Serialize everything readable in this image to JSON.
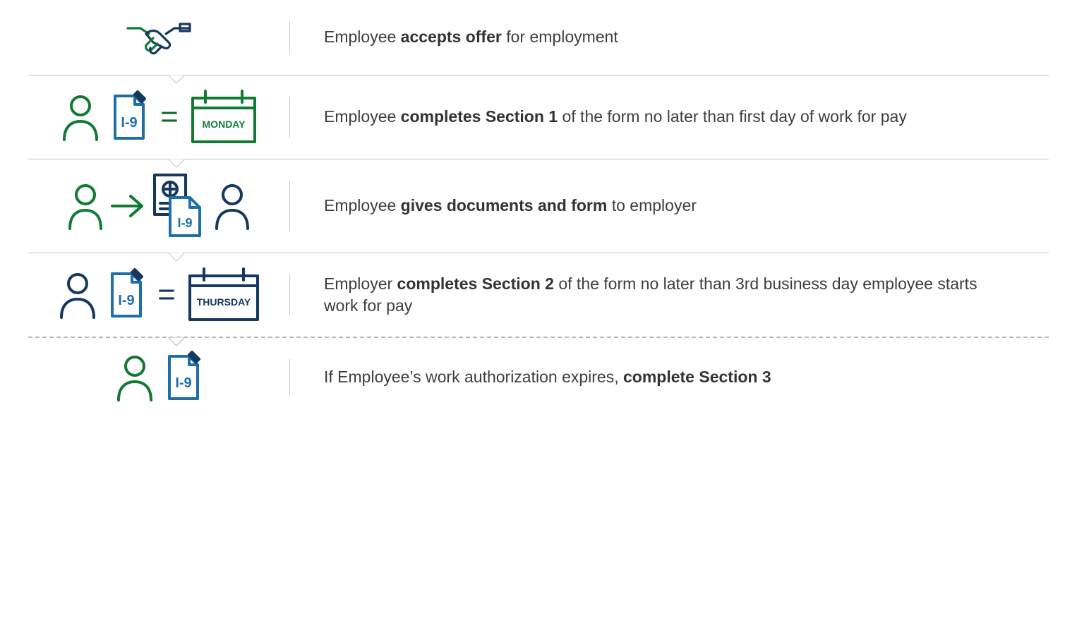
{
  "colors": {
    "green": "#117a33",
    "navy": "#14385f",
    "blue": "#1e6fa8",
    "text": "#3d3d3d"
  },
  "steps": [
    {
      "pre": "Employee ",
      "bold": "accepts offer",
      "post": " for employment"
    },
    {
      "pre": "Employee ",
      "bold": "completes Section 1",
      "post": " of the form no later than first day of work for pay",
      "calendar_label": "MONDAY",
      "form_label": "I-9"
    },
    {
      "pre": "Employee ",
      "bold": "gives documents and form",
      "post": " to employer",
      "form_label": "I-9"
    },
    {
      "pre": "Employer ",
      "bold": "completes Section 2",
      "post": " of the form no later than 3rd business day employee starts work for pay",
      "calendar_label": "THURSDAY",
      "form_label": "I-9"
    },
    {
      "pre": "If Employee’s work authorization expires, ",
      "bold": "complete Section 3",
      "post": "",
      "form_label": "I-9"
    }
  ]
}
